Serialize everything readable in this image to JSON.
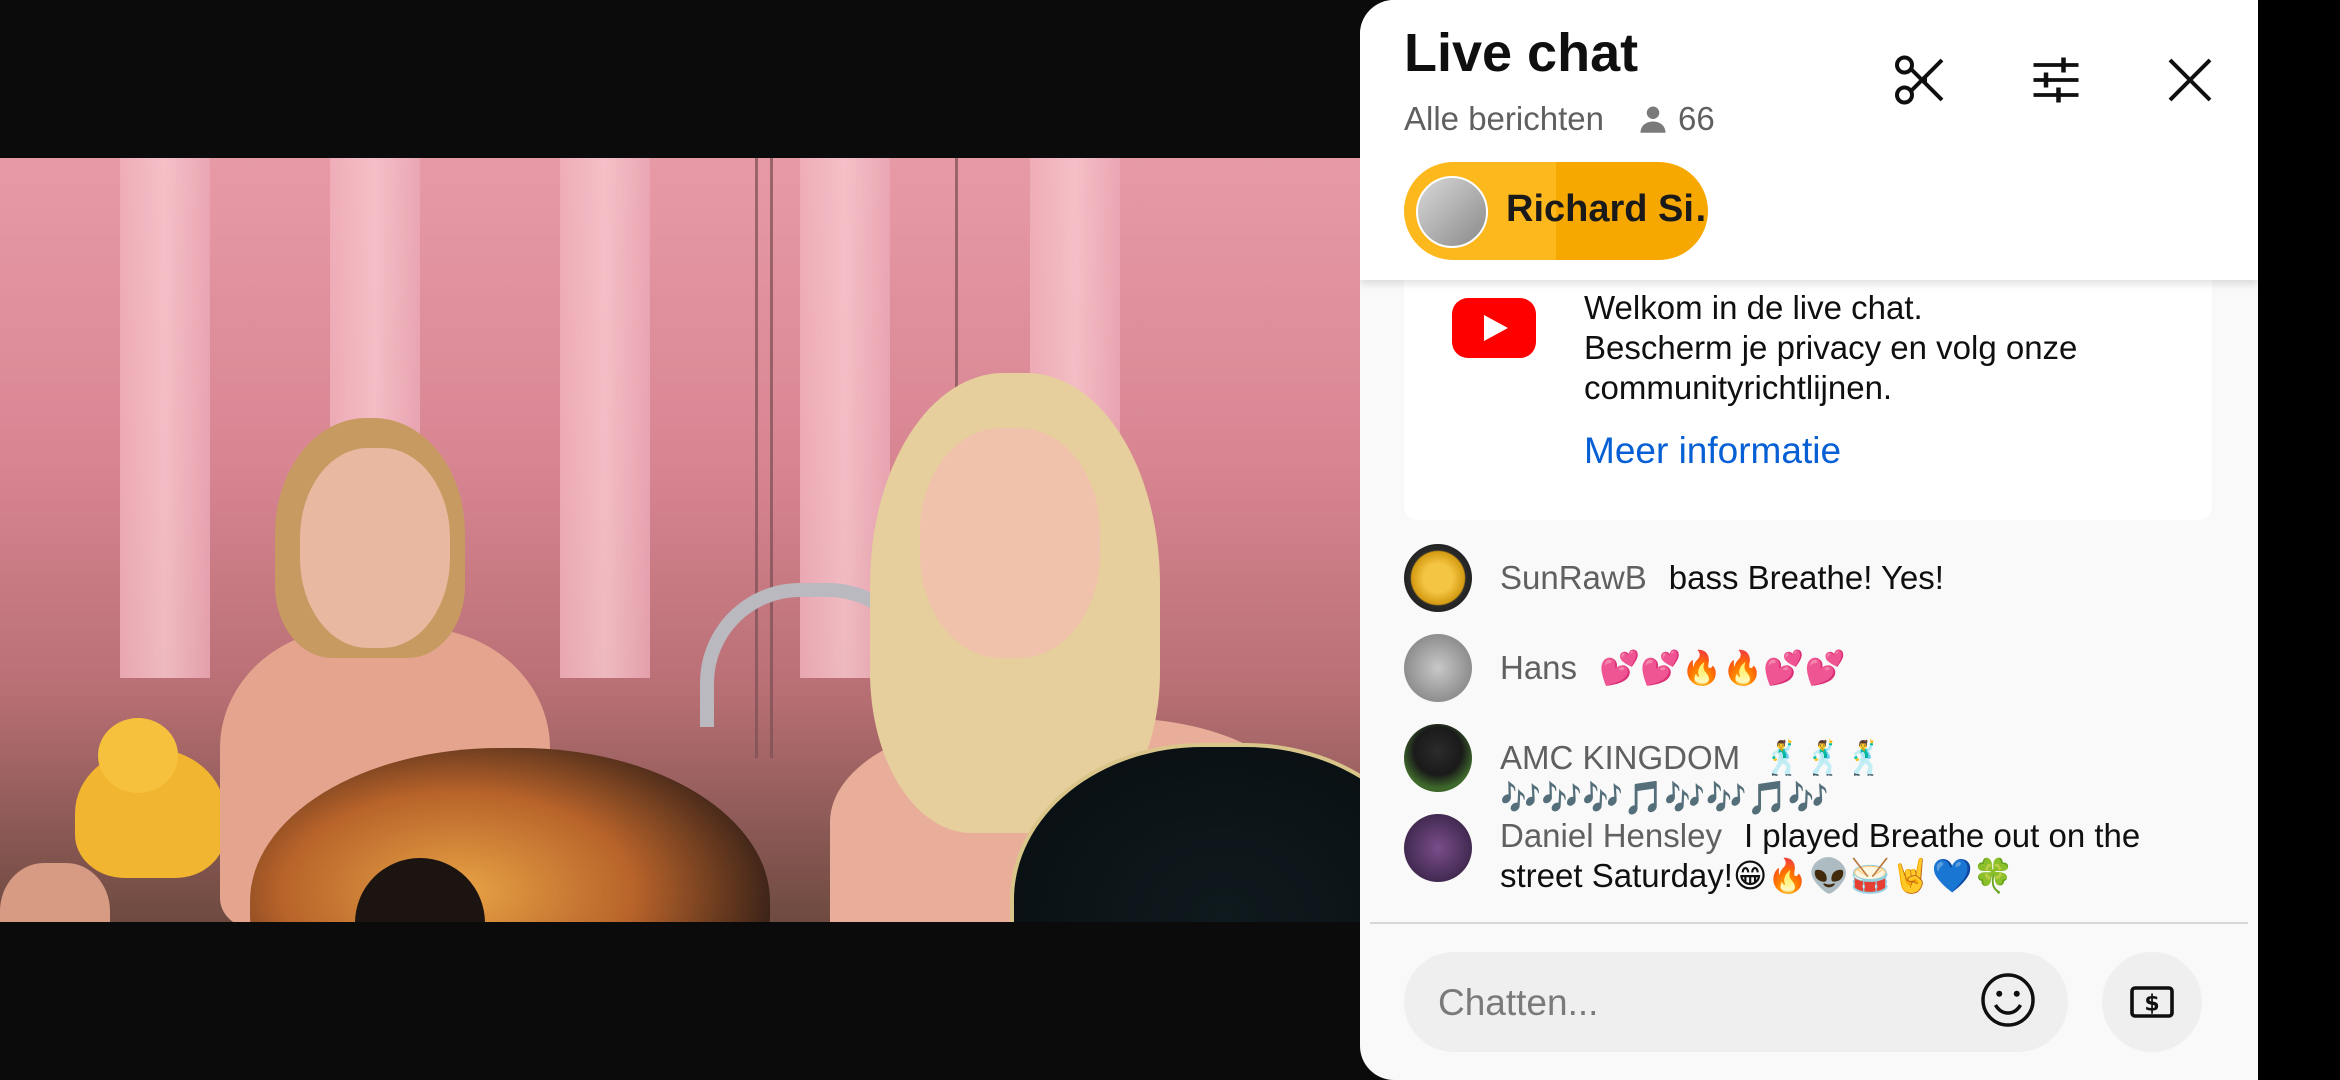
{
  "chat": {
    "title": "Live chat",
    "filter": "Alle berichten",
    "viewer_count": "66",
    "pinned_user": "Richard Si…",
    "welcome_line1": "Welkom in de live chat.",
    "welcome_line2": "Bescherm je privacy en volg onze",
    "welcome_line3": "communityrichtlijnen.",
    "welcome_link": "Meer informatie",
    "messages": [
      {
        "author": "SunRawB",
        "text": "bass Breathe! Yes!"
      },
      {
        "author": "Hans",
        "text": "💕💕🔥🔥💕💕"
      },
      {
        "author": "AMC KINGDOM",
        "text": "🕺🕺🕺🎶🎶🎶🎵🎶🎶🎵🎶"
      },
      {
        "author": "Daniel Hensley",
        "text": "I played Breathe out on the street Saturday!😁🔥👽🥁🤘💙🍀"
      }
    ],
    "input_placeholder": "Chatten..."
  },
  "icons": {
    "clip": "scissors-icon",
    "filter": "sliders-icon",
    "close": "close-icon",
    "viewers": "person-icon",
    "emoji": "smiley-icon",
    "donate": "dollar-bill-icon",
    "logo": "youtube-logo"
  },
  "colors": {
    "pill": "#fdb81d",
    "link": "#065fd4",
    "youtube_red": "#ff0000"
  }
}
